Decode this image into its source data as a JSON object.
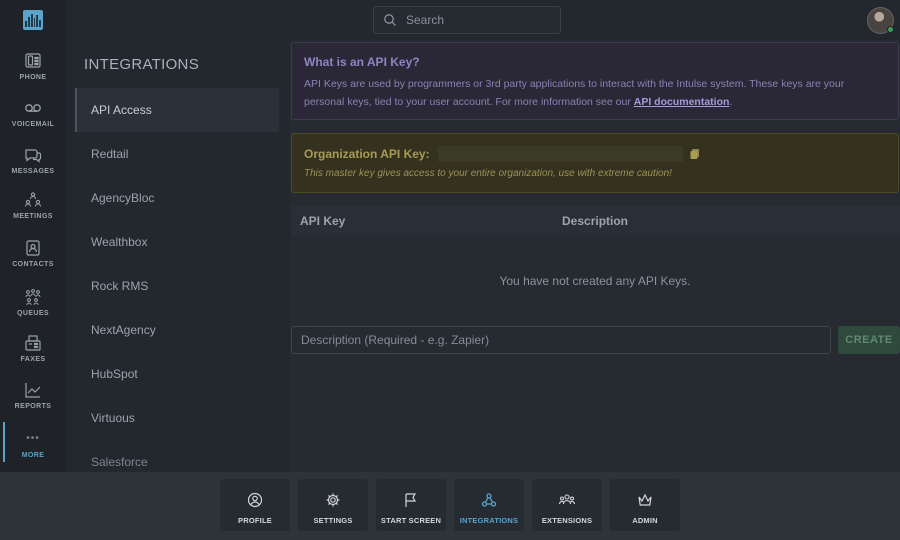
{
  "search": {
    "placeholder": "Search"
  },
  "nav": {
    "items": [
      {
        "label": "PHONE",
        "icon": "phone-icon"
      },
      {
        "label": "VOICEMAIL",
        "icon": "voicemail-icon"
      },
      {
        "label": "MESSAGES",
        "icon": "messages-icon"
      },
      {
        "label": "MEETINGS",
        "icon": "meetings-icon"
      },
      {
        "label": "CONTACTS",
        "icon": "contacts-icon"
      },
      {
        "label": "QUEUES",
        "icon": "queues-icon"
      },
      {
        "label": "FAXES",
        "icon": "faxes-icon"
      },
      {
        "label": "REPORTS",
        "icon": "reports-icon"
      },
      {
        "label": "MORE",
        "icon": "more-icon"
      }
    ]
  },
  "integrations": {
    "title": "INTEGRATIONS",
    "items": [
      "API Access",
      "Redtail",
      "AgencyBloc",
      "Wealthbox",
      "Rock RMS",
      "NextAgency",
      "HubSpot",
      "Virtuous",
      "Salesforce"
    ]
  },
  "api_info": {
    "title": "What is an API Key?",
    "text": "API Keys are used by programmers or 3rd party applications to interact with the Intulse system. These keys are your personal keys, tied to your user account. For more information see our",
    "link": "API documentation",
    "period": "."
  },
  "org_key": {
    "title": "Organization API Key:",
    "warning": "This master key gives access to your entire organization, use with extreme caution!"
  },
  "table": {
    "headers": [
      "API Key",
      "Description"
    ],
    "empty_message": "You have not created any API Keys."
  },
  "create": {
    "placeholder": "Description (Required - e.g. Zapier)",
    "button": "CREATE"
  },
  "dock": {
    "items": [
      "PROFILE",
      "SETTINGS",
      "START SCREEN",
      "INTEGRATIONS",
      "EXTENSIONS",
      "ADMIN"
    ]
  },
  "colors": {
    "accent": "#5aa3c9",
    "info_bg": "#2a2836",
    "warning_bg": "#34321f",
    "create_button": "#2f4a3c"
  }
}
